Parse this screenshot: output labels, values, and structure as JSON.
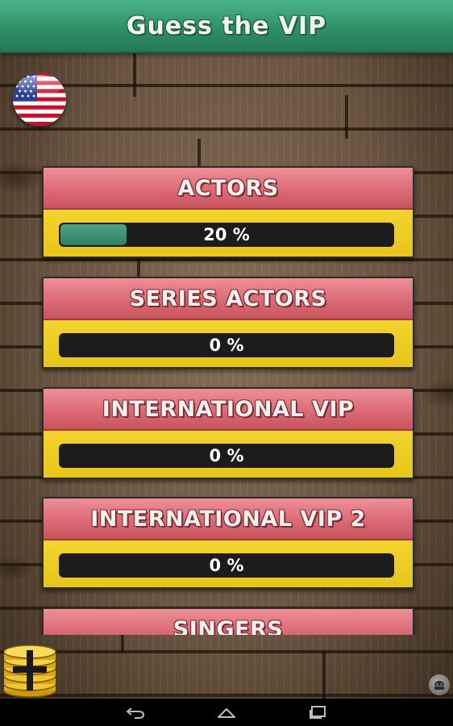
{
  "app": {
    "title": "Guess the VIP"
  },
  "language": {
    "flag_icon": "us-flag-icon"
  },
  "categories": [
    {
      "label": "ACTORS",
      "progress_text": "20 %",
      "progress": 0.2
    },
    {
      "label": "SERIES ACTORS",
      "progress_text": "0 %",
      "progress": 0
    },
    {
      "label": "INTERNATIONAL VIP",
      "progress_text": "0 %",
      "progress": 0
    },
    {
      "label": "INTERNATIONAL VIP 2",
      "progress_text": "0 %",
      "progress": 0
    },
    {
      "label": "SINGERS"
    }
  ],
  "footer": {
    "coins_icon": "coins-plus-icon",
    "robot_icon": "android-icon"
  },
  "navbar": {
    "back_icon": "back-icon",
    "home_icon": "home-icon",
    "recents_icon": "recents-icon"
  },
  "colors": {
    "header": "#2f8f67",
    "card_title": "#d96872",
    "card_body": "#e8c81f",
    "progress_fill": "#2f7e63",
    "progress_track": "#1c1c1c"
  }
}
